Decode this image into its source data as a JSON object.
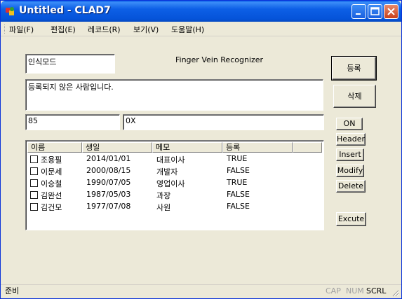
{
  "window": {
    "title": "Untitled - CLAD7"
  },
  "menu": [
    {
      "label": "파일(F)"
    },
    {
      "label": "편집(E)"
    },
    {
      "label": "레코드(R)"
    },
    {
      "label": "보기(V)"
    },
    {
      "label": "도움말(H)"
    }
  ],
  "form": {
    "mode_value": "인식모드",
    "app_label": "Finger Vein Recognizer",
    "message_value": "등록되지 않은 사람입니다.",
    "score_value": "85",
    "hex_value": "0X"
  },
  "buttons": {
    "register": "등록",
    "delete": "삭제",
    "on": "ON",
    "header": "Header",
    "insert": "Insert",
    "modify": "Modify",
    "delete_row": "Delete",
    "execute": "Excute"
  },
  "table": {
    "columns": [
      "이름",
      "생일",
      "메모",
      "등록"
    ],
    "rows": [
      {
        "name": "조용필",
        "birthday": "2014/01/01",
        "memo": "대표이사",
        "registered": "TRUE"
      },
      {
        "name": "이문세",
        "birthday": "2000/08/15",
        "memo": "개발자",
        "registered": "FALSE"
      },
      {
        "name": "이승철",
        "birthday": "1990/07/05",
        "memo": "영업이사",
        "registered": "TRUE"
      },
      {
        "name": "김완선",
        "birthday": "1987/05/03",
        "memo": "과장",
        "registered": "FALSE"
      },
      {
        "name": "김건모",
        "birthday": "1977/07/08",
        "memo": "사원",
        "registered": "FALSE"
      }
    ]
  },
  "status": {
    "text": "준비",
    "cap": "CAP",
    "num": "NUM",
    "scrl": "SCRL"
  }
}
